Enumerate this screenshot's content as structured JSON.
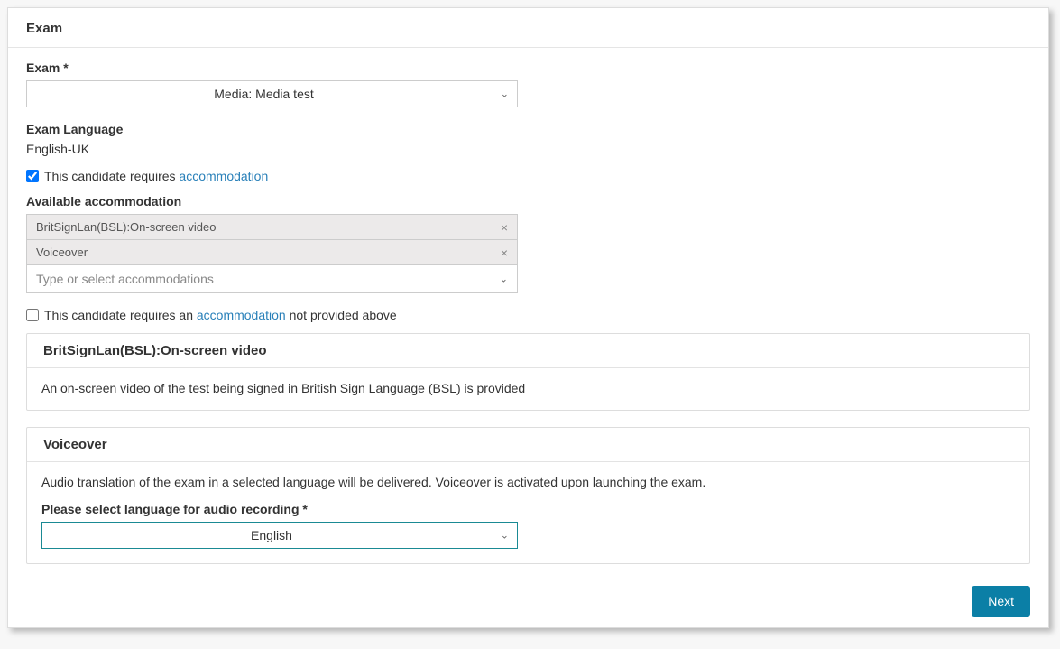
{
  "card": {
    "title": "Exam"
  },
  "exam_field": {
    "label": "Exam *",
    "value": "Media: Media test"
  },
  "language_field": {
    "label": "Exam Language",
    "value": "English-UK"
  },
  "requires_accom": {
    "prefix": "This candidate requires ",
    "link": "accommodation",
    "checked": true
  },
  "available_accom": {
    "label": "Available accommodation",
    "tags": [
      {
        "label": "BritSignLan(BSL):On-screen video"
      },
      {
        "label": "Voiceover"
      }
    ],
    "placeholder": "Type or select accommodations"
  },
  "requires_other": {
    "prefix": "This candidate requires an ",
    "link": "accommodation",
    "suffix": " not provided above",
    "checked": false
  },
  "panel_bsl": {
    "title": "BritSignLan(BSL):On-screen video",
    "desc": "An on-screen video of the test being signed in British Sign Language (BSL) is provided"
  },
  "panel_voiceover": {
    "title": "Voiceover",
    "desc": "Audio translation of the exam in a selected language will be delivered. Voiceover is activated upon launching the exam.",
    "select_label": "Please select language for audio recording *",
    "select_value": "English"
  },
  "footer": {
    "next": "Next"
  }
}
